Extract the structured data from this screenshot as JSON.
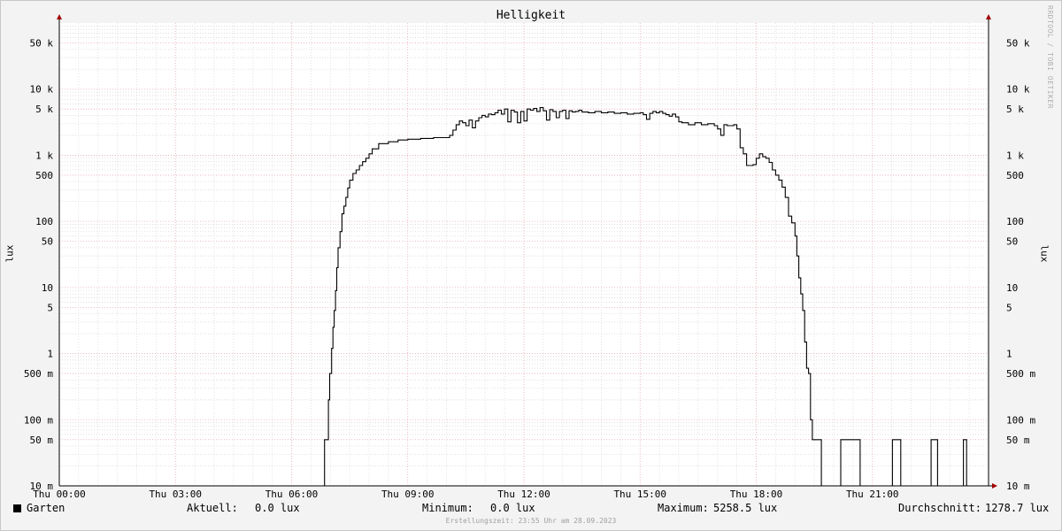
{
  "title": "Helligkeit",
  "watermark": "RRDTOOL / TOBI OETIKER",
  "chart_data": {
    "type": "line",
    "title": "Helligkeit",
    "ylabel": "lux",
    "ylabel_right": "lux",
    "yscale": "log",
    "ylim": [
      0.01,
      100000
    ],
    "xlim": [
      "00:00",
      "24:00"
    ],
    "grid": true,
    "x_ticks": [
      "Thu 00:00",
      "Thu 03:00",
      "Thu 06:00",
      "Thu 09:00",
      "Thu 12:00",
      "Thu 15:00",
      "Thu 18:00",
      "Thu 21:00"
    ],
    "y_ticks": [
      {
        "value": 0.01,
        "label": "10 m"
      },
      {
        "value": 0.05,
        "label": "50 m"
      },
      {
        "value": 0.1,
        "label": "100 m"
      },
      {
        "value": 0.5,
        "label": "500 m"
      },
      {
        "value": 1,
        "label": "1"
      },
      {
        "value": 5,
        "label": "5"
      },
      {
        "value": 10,
        "label": "10"
      },
      {
        "value": 50,
        "label": "50"
      },
      {
        "value": 100,
        "label": "100"
      },
      {
        "value": 500,
        "label": "500"
      },
      {
        "value": 1000,
        "label": "1 k"
      },
      {
        "value": 5000,
        "label": "5 k"
      },
      {
        "value": 10000,
        "label": "10 k"
      },
      {
        "value": 50000,
        "label": "50 k"
      }
    ],
    "series": [
      {
        "name": "Garten",
        "color": "#000000",
        "points": [
          [
            "00:00",
            0.01
          ],
          [
            "06:50",
            0.01
          ],
          [
            "06:51",
            0.05
          ],
          [
            "06:56",
            0.05
          ],
          [
            "06:57",
            0.2
          ],
          [
            "06:59",
            0.5
          ],
          [
            "07:02",
            1.2
          ],
          [
            "07:04",
            2.5
          ],
          [
            "07:06",
            4.5
          ],
          [
            "07:08",
            9
          ],
          [
            "07:10",
            20
          ],
          [
            "07:12",
            40
          ],
          [
            "07:15",
            70
          ],
          [
            "07:18",
            130
          ],
          [
            "07:21",
            170
          ],
          [
            "07:24",
            230
          ],
          [
            "07:27",
            320
          ],
          [
            "07:30",
            420
          ],
          [
            "07:35",
            530
          ],
          [
            "07:40",
            600
          ],
          [
            "07:45",
            700
          ],
          [
            "07:50",
            800
          ],
          [
            "07:55",
            900
          ],
          [
            "08:00",
            1050
          ],
          [
            "08:05",
            1250
          ],
          [
            "08:15",
            1500
          ],
          [
            "08:30",
            1600
          ],
          [
            "08:45",
            1700
          ],
          [
            "09:00",
            1750
          ],
          [
            "09:20",
            1800
          ],
          [
            "09:40",
            1850
          ],
          [
            "10:00",
            1850
          ],
          [
            "10:05",
            2000
          ],
          [
            "10:10",
            2400
          ],
          [
            "10:15",
            2900
          ],
          [
            "10:20",
            3300
          ],
          [
            "10:25",
            3100
          ],
          [
            "10:30",
            2800
          ],
          [
            "10:35",
            3400
          ],
          [
            "10:40",
            2600
          ],
          [
            "10:45",
            3300
          ],
          [
            "10:50",
            3700
          ],
          [
            "10:55",
            4000
          ],
          [
            "11:00",
            3800
          ],
          [
            "11:05",
            4200
          ],
          [
            "11:10",
            4100
          ],
          [
            "11:15",
            4400
          ],
          [
            "11:20",
            4800
          ],
          [
            "11:25",
            4200
          ],
          [
            "11:30",
            5000
          ],
          [
            "11:35",
            3200
          ],
          [
            "11:40",
            4800
          ],
          [
            "11:45",
            4500
          ],
          [
            "11:50",
            3100
          ],
          [
            "11:55",
            4600
          ],
          [
            "12:00",
            3300
          ],
          [
            "12:05",
            5000
          ],
          [
            "12:10",
            4800
          ],
          [
            "12:15",
            5100
          ],
          [
            "12:20",
            4600
          ],
          [
            "12:25",
            5258
          ],
          [
            "12:30",
            4700
          ],
          [
            "12:35",
            3400
          ],
          [
            "12:40",
            4900
          ],
          [
            "12:45",
            4600
          ],
          [
            "12:50",
            3700
          ],
          [
            "12:55",
            4600
          ],
          [
            "13:00",
            4800
          ],
          [
            "13:05",
            3600
          ],
          [
            "13:10",
            4700
          ],
          [
            "13:15",
            4500
          ],
          [
            "13:20",
            4600
          ],
          [
            "13:25",
            4800
          ],
          [
            "13:30",
            4500
          ],
          [
            "13:40",
            4400
          ],
          [
            "13:50",
            4600
          ],
          [
            "14:00",
            4400
          ],
          [
            "14:10",
            4500
          ],
          [
            "14:20",
            4300
          ],
          [
            "14:30",
            4400
          ],
          [
            "14:40",
            4200
          ],
          [
            "14:50",
            4300
          ],
          [
            "15:00",
            4400
          ],
          [
            "15:05",
            4100
          ],
          [
            "15:10",
            3500
          ],
          [
            "15:15",
            4300
          ],
          [
            "15:20",
            4600
          ],
          [
            "15:25",
            4400
          ],
          [
            "15:30",
            4600
          ],
          [
            "15:35",
            4300
          ],
          [
            "15:40",
            4100
          ],
          [
            "15:45",
            3900
          ],
          [
            "15:50",
            4200
          ],
          [
            "15:55",
            3800
          ],
          [
            "16:00",
            3200
          ],
          [
            "16:05",
            3100
          ],
          [
            "16:15",
            2900
          ],
          [
            "16:25",
            3100
          ],
          [
            "16:35",
            2900
          ],
          [
            "16:45",
            3000
          ],
          [
            "16:55",
            2800
          ],
          [
            "17:00",
            2500
          ],
          [
            "17:05",
            2000
          ],
          [
            "17:10",
            2900
          ],
          [
            "17:15",
            2800
          ],
          [
            "17:25",
            2900
          ],
          [
            "17:30",
            2500
          ],
          [
            "17:35",
            1300
          ],
          [
            "17:40",
            1050
          ],
          [
            "17:45",
            700
          ],
          [
            "17:50",
            700
          ],
          [
            "17:55",
            720
          ],
          [
            "18:00",
            900
          ],
          [
            "18:05",
            1050
          ],
          [
            "18:10",
            950
          ],
          [
            "18:15",
            900
          ],
          [
            "18:20",
            780
          ],
          [
            "18:25",
            600
          ],
          [
            "18:30",
            500
          ],
          [
            "18:35",
            420
          ],
          [
            "18:40",
            330
          ],
          [
            "18:45",
            230
          ],
          [
            "18:50",
            120
          ],
          [
            "18:55",
            95
          ],
          [
            "19:00",
            60
          ],
          [
            "19:03",
            30
          ],
          [
            "19:06",
            14
          ],
          [
            "19:09",
            8
          ],
          [
            "19:12",
            4.5
          ],
          [
            "19:15",
            1.5
          ],
          [
            "19:18",
            0.6
          ],
          [
            "19:21",
            0.5
          ],
          [
            "19:24",
            0.1
          ],
          [
            "19:27",
            0.05
          ],
          [
            "19:40",
            0.05
          ],
          [
            "19:41",
            0.01
          ],
          [
            "20:10",
            0.01
          ],
          [
            "20:11",
            0.05
          ],
          [
            "20:40",
            0.05
          ],
          [
            "20:41",
            0.01
          ],
          [
            "21:30",
            0.01
          ],
          [
            "21:31",
            0.05
          ],
          [
            "21:43",
            0.05
          ],
          [
            "21:44",
            0.01
          ],
          [
            "22:30",
            0.01
          ],
          [
            "22:31",
            0.05
          ],
          [
            "22:40",
            0.05
          ],
          [
            "22:41",
            0.01
          ],
          [
            "23:20",
            0.01
          ],
          [
            "23:21",
            0.05
          ],
          [
            "23:25",
            0.05
          ],
          [
            "23:26",
            0.01
          ],
          [
            "23:55",
            0.01
          ]
        ]
      }
    ]
  },
  "legend": {
    "series_name": "Garten",
    "current_label": "Aktuell:",
    "current_value": "0.0 lux",
    "min_label": "Minimum:",
    "min_value": "0.0 lux",
    "max_label": "Maximum:",
    "max_value": "5258.5 lux",
    "avg_label": "Durchschnitt:",
    "avg_value": "1278.7 lux"
  },
  "footer": "Erstellungszeit: 23:55 Uhr am 28.09.2023"
}
